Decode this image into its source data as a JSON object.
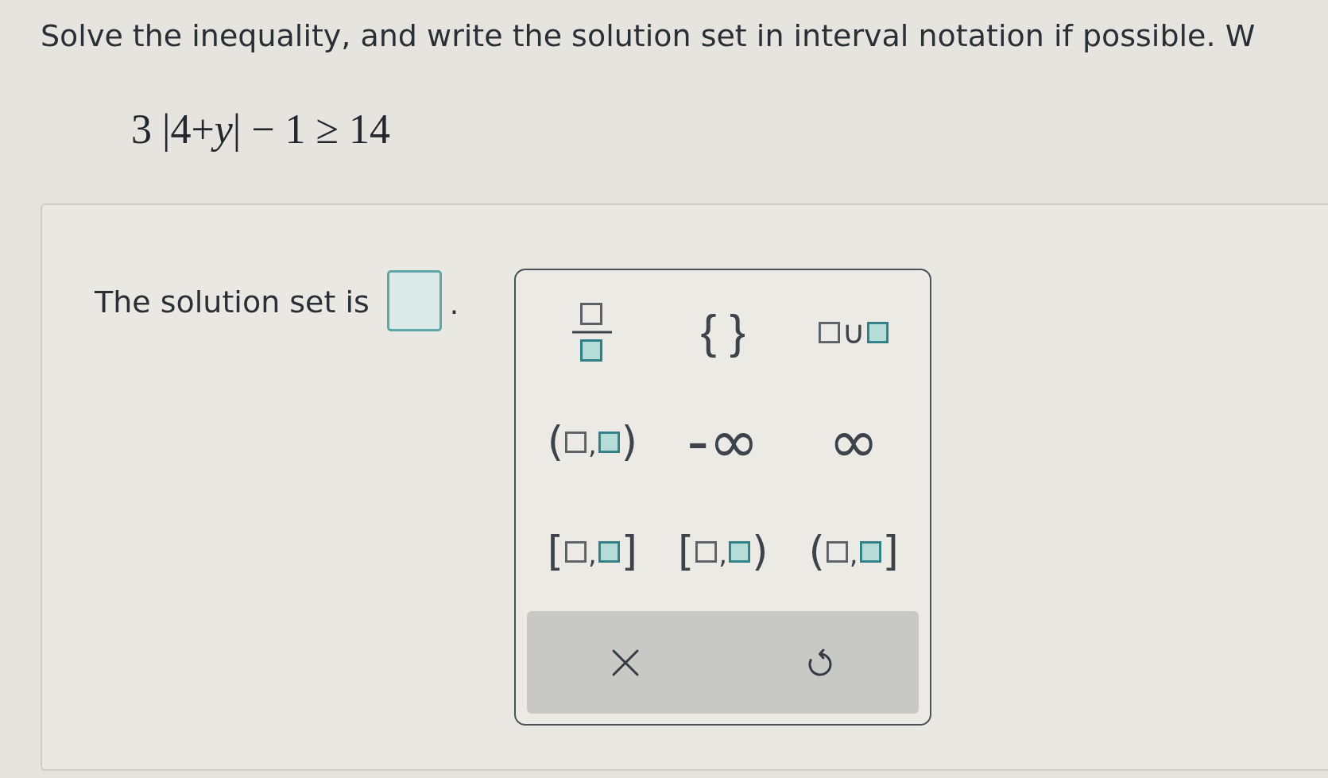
{
  "question": {
    "prompt": "Solve the inequality, and write the solution set in interval notation if possible. W",
    "equation": "3 |4+*y*| − 1 ≥ 14"
  },
  "answer_area": {
    "label": "The solution set is",
    "end": "."
  },
  "keypad": {
    "keys": [
      {
        "kind": "fraction"
      },
      {
        "kind": "braces",
        "label": "{ }"
      },
      {
        "kind": "union",
        "operator": "∪"
      },
      {
        "kind": "interval",
        "left": "(",
        "separator": ",",
        "right": ")"
      },
      {
        "kind": "symbol",
        "label": "-∞"
      },
      {
        "kind": "symbol",
        "label": "∞"
      },
      {
        "kind": "interval",
        "left": "[",
        "separator": ",",
        "right": "]"
      },
      {
        "kind": "interval",
        "left": "[",
        "separator": ",",
        "right": ")"
      },
      {
        "kind": "interval",
        "left": "(",
        "separator": ",",
        "right": "]"
      }
    ],
    "actions": [
      {
        "kind": "clear"
      },
      {
        "kind": "undo"
      }
    ]
  }
}
